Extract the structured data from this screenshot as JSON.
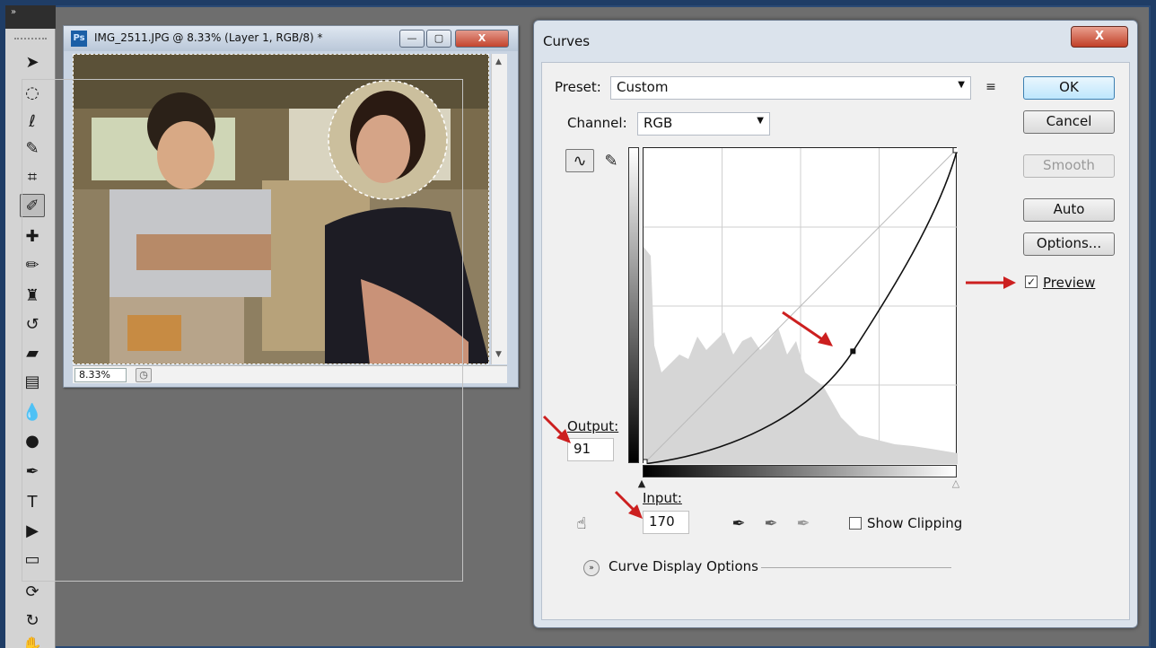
{
  "document": {
    "badge": "Ps",
    "title": "IMG_2511.JPG @ 8.33% (Layer 1, RGB/8) *",
    "zoom": "8.33%",
    "buttons": {
      "minimize": "—",
      "maximize": "▢",
      "close": "X"
    }
  },
  "toolbar": {
    "grip": "»",
    "tools": [
      "move-tool",
      "marquee-tool",
      "lasso-tool",
      "quick-select-tool",
      "crop-tool",
      "eyedropper-tool",
      "spot-healing-tool",
      "brush-tool",
      "clone-stamp-tool",
      "history-brush-tool",
      "eraser-tool",
      "gradient-tool",
      "blur-tool",
      "dodge-tool",
      "pen-tool",
      "type-tool",
      "path-select-tool",
      "rectangle-tool",
      "3d-rotate-tool",
      "3d-orbit-tool",
      "hand-tool"
    ],
    "active": "eyedropper-tool"
  },
  "curves": {
    "title": "Curves",
    "close": "X",
    "preset_label": "Preset:",
    "preset_value": "Custom",
    "channel_label": "Channel:",
    "channel_value": "RGB",
    "buttons": {
      "ok": "OK",
      "cancel": "Cancel",
      "smooth": "Smooth",
      "auto": "Auto",
      "options": "Options..."
    },
    "preview_label": "Preview",
    "preview_checked": true,
    "output_label": "Output:",
    "output_value": "91",
    "input_label": "Input:",
    "input_value": "170",
    "show_clipping_label": "Show Clipping",
    "show_clipping_checked": false,
    "curve_display_label": "Curve Display Options",
    "curve_point": {
      "input": 170,
      "output": 91
    }
  },
  "icons": {
    "curve_tool": "curve-icon",
    "pencil_tool": "pencil-icon",
    "preset_menu": "menu-icon",
    "on_image": "hand-adjust-icon",
    "black_point": "black-eyedropper-icon",
    "gray_point": "gray-eyedropper-icon",
    "white_point": "white-eyedropper-icon",
    "expand": "chevron-down-icon"
  },
  "colors": {
    "annotation_arrow": "#cc1f1f",
    "accent": "#3c7fb1"
  }
}
